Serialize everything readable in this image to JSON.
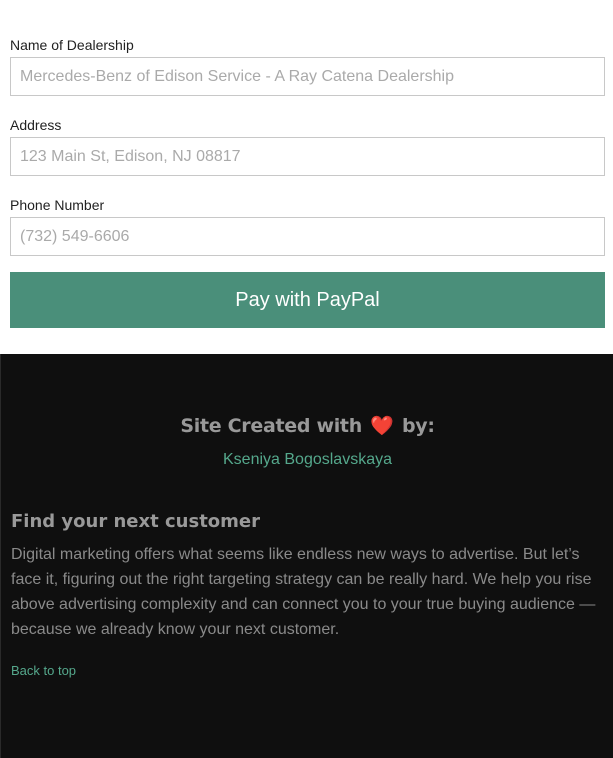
{
  "form": {
    "dealership": {
      "label": "Name of Dealership",
      "placeholder": "Mercedes-Benz of Edison Service - A Ray Catena Dealership"
    },
    "address": {
      "label": "Address",
      "placeholder": "123 Main St, Edison, NJ 08817"
    },
    "phone": {
      "label": "Phone Number",
      "placeholder": "(732) 549-6606"
    },
    "submit_label": "Pay with PayPal"
  },
  "footer": {
    "credit_prefix": "Site Created with",
    "credit_heart": "❤️",
    "credit_suffix": "by:",
    "author": "Kseniya Bogoslavskaya",
    "heading": "Find your next customer",
    "body": "Digital marketing offers what seems like endless new ways to advertise. But let’s face it, figuring out the right targeting strategy can be really hard. We help you rise above advertising complexity and can connect you to your true buying audience — because we already know your next customer.",
    "back_to_top": "Back to top"
  },
  "colors": {
    "button": "#4a8f7a",
    "link": "#55a88c",
    "footer_bg": "#0f0f0f"
  }
}
